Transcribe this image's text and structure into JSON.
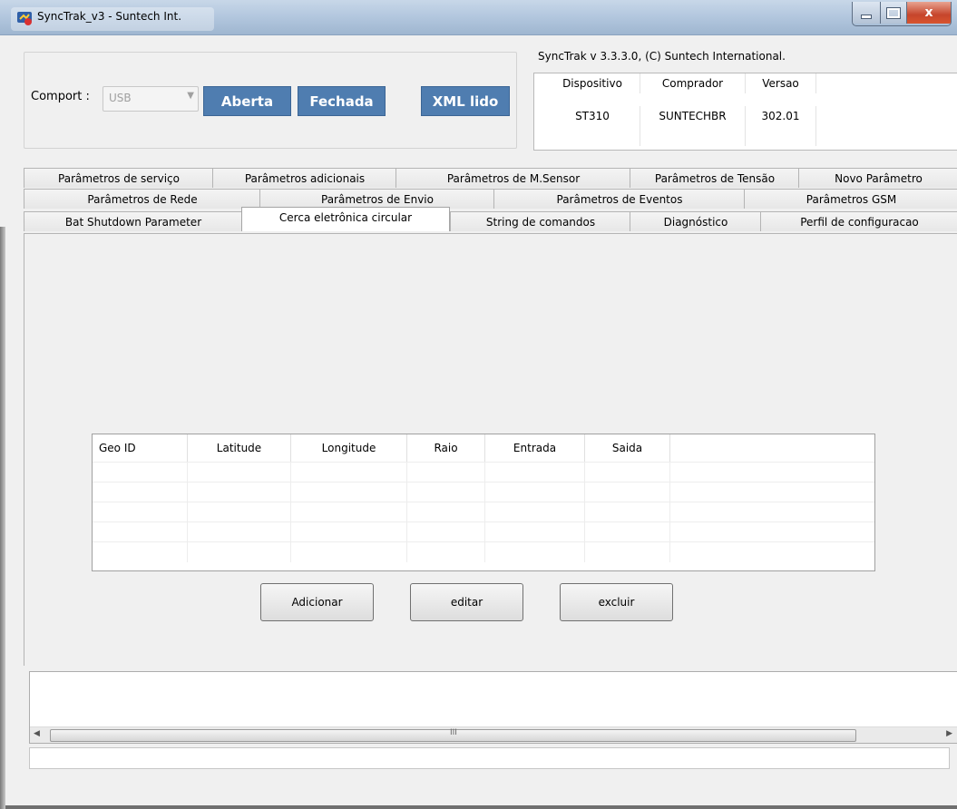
{
  "window": {
    "title": "SyncTrak_v3 - Suntech Int.",
    "close_glyph": "x"
  },
  "comport": {
    "label": "Comport :",
    "selected": "USB",
    "buttons": [
      "Aberta",
      "Fechada",
      "XML lido"
    ]
  },
  "version_text": "SyncTrak v 3.3.3.0, (C) Suntech International.",
  "device_table": {
    "columns": [
      "Dispositivo",
      "Comprador",
      "Versao"
    ],
    "rows": [
      [
        "ST310",
        "SUNTECHBR",
        "302.01"
      ]
    ]
  },
  "tabs": {
    "row1": [
      "Parâmetros de serviço",
      "Parâmetros adicionais",
      "Parâmetros  de M.Sensor",
      "Parâmetros de Tensão",
      "Novo Parâmetro"
    ],
    "row2": [
      "Parâmetros de Rede",
      "Parâmetros de Envio",
      "Parâmetros de Eventos",
      "Parâmetros GSM"
    ],
    "row3": [
      "Bat Shutdown Parameter",
      "Cerca eletrônica circular",
      "String de comandos",
      "Diagnóstico",
      "Perfil de configuracao"
    ],
    "active": "Cerca eletrônica circular"
  },
  "geo_table": {
    "columns": [
      "Geo ID",
      "Latitude",
      "Longitude",
      "Raio",
      "Entrada",
      "Saida"
    ]
  },
  "actions": [
    "Adicionar",
    "editar",
    "excluir"
  ],
  "scrollbar": {
    "left_arrow": "◀",
    "right_arrow": "▶",
    "grip": "III"
  },
  "colors": {
    "accent_button": "#4f7db0",
    "titlebar": "#b4c8df"
  }
}
